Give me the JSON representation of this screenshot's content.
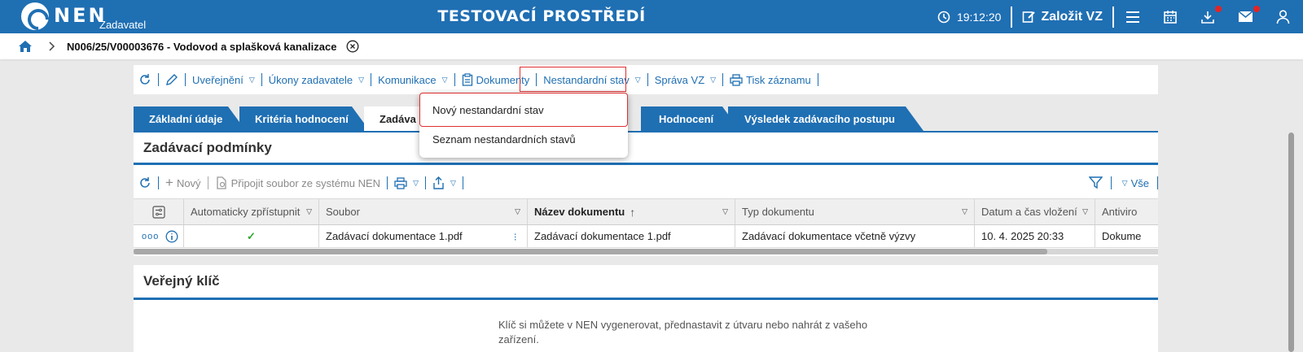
{
  "topbar": {
    "logo_text": "NEN",
    "logo_sub": "Zadavatel",
    "env_title": "TESTOVACÍ PROSTŘEDÍ",
    "clock": "19:12:20",
    "create_label": "Založit VZ",
    "icons": [
      "clock-icon",
      "edit-icon",
      "menu-icon",
      "calendar-icon",
      "download-icon",
      "mail-icon",
      "user-icon"
    ],
    "notification_color": "#e42424"
  },
  "breadcrumb": {
    "text": "N006/25/V00003676 - Vodovod a splašková kanalizace"
  },
  "toolbar": {
    "items": [
      {
        "label": "Uveřejnění",
        "dropdown": true
      },
      {
        "label": "Úkony zadavatele",
        "dropdown": true
      },
      {
        "label": "Komunikace",
        "dropdown": true
      },
      {
        "label": "Dokumenty",
        "dropdown": false
      },
      {
        "label": "Nestandardní stav",
        "dropdown": true
      },
      {
        "label": "Správa VZ",
        "dropdown": true
      },
      {
        "label": "Tisk záznamu",
        "dropdown": false
      }
    ]
  },
  "tabs": [
    {
      "label": "Základní údaje"
    },
    {
      "label": "Kritéria hodnocení"
    },
    {
      "label": "Zadáva"
    },
    {
      "label": "Hodnocení"
    },
    {
      "label": "Výsledek zadávacího postupu"
    }
  ],
  "dropdown_menu": {
    "items": [
      "Nový nestandardní stav",
      "Seznam nestandardních stavů"
    ]
  },
  "section_conditions": {
    "title": "Zadávací podmínky",
    "toolbar": {
      "new_label": "Nový",
      "attach_label": "Připojit soubor ze systému NEN",
      "all_label": "Vše"
    },
    "table": {
      "columns": [
        "Automaticky zpřístupnit",
        "Soubor",
        "Název dokumentu",
        "Typ dokumentu",
        "Datum a čas vložení",
        "Antiviro"
      ],
      "rows": [
        {
          "auto": "✓",
          "file": "Zadávací dokumentace 1.pdf",
          "name": "Zadávací dokumentace 1.pdf",
          "type": "Zadávací dokumentace včetně výzvy",
          "date": "10. 4. 2025 20:33",
          "antivirus": "Dokume"
        }
      ]
    }
  },
  "section_key": {
    "title": "Veřejný klíč",
    "text": "Klíč si můžete v NEN vygenerovat, přednastavit z útvaru nebo nahrát z vašeho zařízení."
  },
  "colors": {
    "brand": "#1f6fb3",
    "highlight": "#e03030",
    "check": "#2eaa2e"
  }
}
